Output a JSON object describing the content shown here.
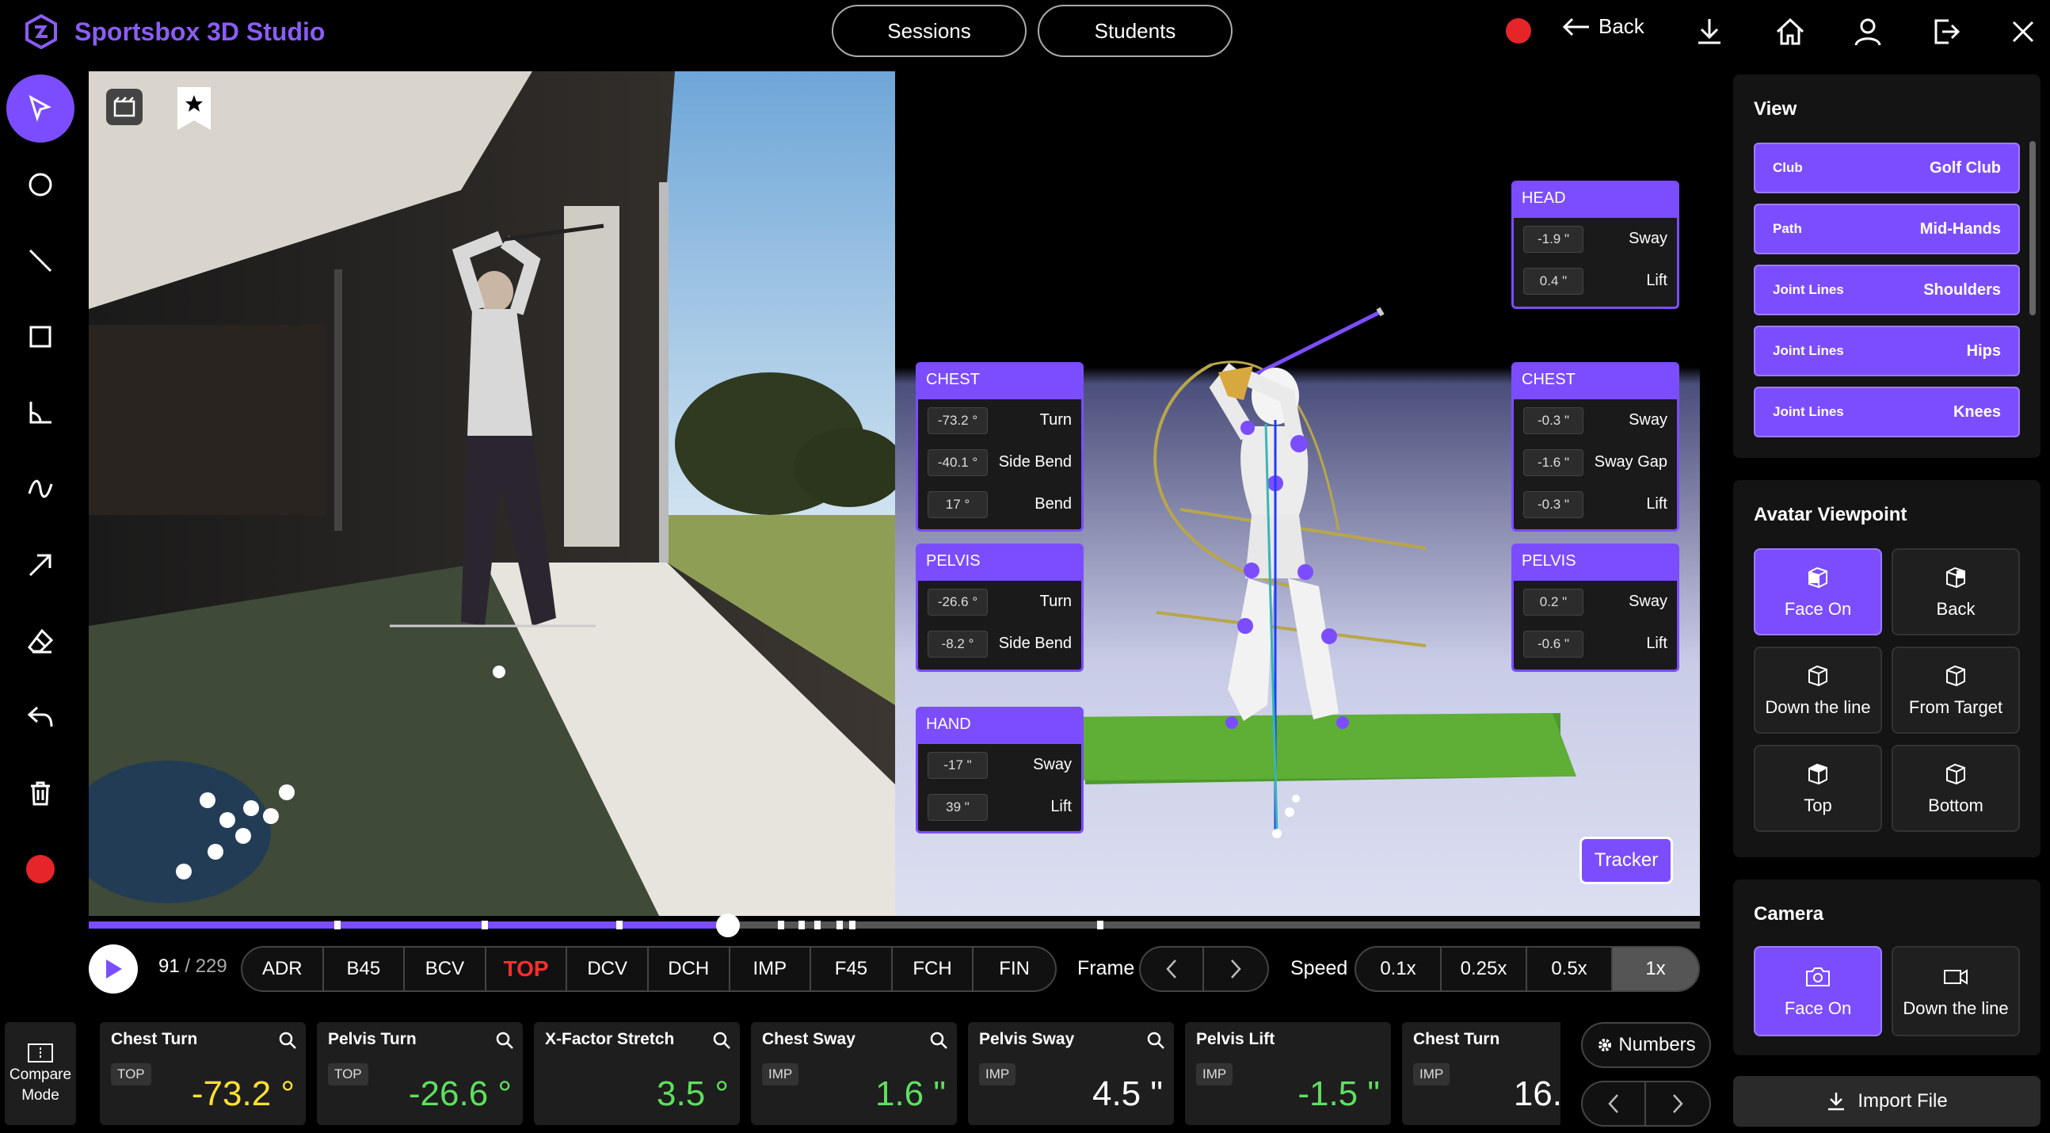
{
  "app": {
    "title": "Sportsbox 3D Studio"
  },
  "header": {
    "sessions_label": "Sessions",
    "students_label": "Students",
    "back_label": "Back"
  },
  "colors": {
    "accent": "#7c4dff",
    "record": "#e5252a",
    "negative": "#ff3b3b",
    "warning": "#ffe033",
    "positive": "#5ee05e"
  },
  "scene": {
    "head": {
      "title": "HEAD",
      "rows": [
        {
          "value": "-1.9 \"",
          "label": "Sway"
        },
        {
          "value": "0.4 \"",
          "label": "Lift"
        }
      ]
    },
    "chest_left": {
      "title": "CHEST",
      "rows": [
        {
          "value": "-73.2 °",
          "label": "Turn"
        },
        {
          "value": "-40.1 °",
          "label": "Side Bend"
        },
        {
          "value": "17 °",
          "label": "Bend"
        }
      ]
    },
    "pelvis_left": {
      "title": "PELVIS",
      "rows": [
        {
          "value": "-26.6 °",
          "label": "Turn"
        },
        {
          "value": "-8.2 °",
          "label": "Side Bend"
        }
      ]
    },
    "hand": {
      "title": "HAND",
      "rows": [
        {
          "value": "-17 \"",
          "label": "Sway"
        },
        {
          "value": "39 \"",
          "label": "Lift"
        }
      ]
    },
    "chest_right": {
      "title": "CHEST",
      "rows": [
        {
          "value": "-0.3 \"",
          "label": "Sway"
        },
        {
          "value": "-1.6 \"",
          "label": "Sway Gap"
        },
        {
          "value": "-0.3 \"",
          "label": "Lift"
        }
      ]
    },
    "pelvis_right": {
      "title": "PELVIS",
      "rows": [
        {
          "value": "0.2 \"",
          "label": "Sway"
        },
        {
          "value": "-0.6 \"",
          "label": "Lift"
        }
      ]
    },
    "tracker_label": "Tracker"
  },
  "right_panel": {
    "view_title": "View",
    "view_items": [
      {
        "key": "Club",
        "value": "Golf Club"
      },
      {
        "key": "Path",
        "value": "Mid-Hands"
      },
      {
        "key": "Joint Lines",
        "value": "Shoulders"
      },
      {
        "key": "Joint Lines",
        "value": "Hips"
      },
      {
        "key": "Joint Lines",
        "value": "Knees"
      }
    ],
    "viewpoint_title": "Avatar Viewpoint",
    "viewpoints": [
      "Face On",
      "Back",
      "Down the line",
      "From Target",
      "Top",
      "Bottom"
    ],
    "camera_title": "Camera",
    "cameras": [
      "Face On",
      "Down the line"
    ],
    "import_label": "Import File"
  },
  "playback": {
    "frame_current": "91",
    "frame_total": "/ 229",
    "progress": 0.397,
    "positions": [
      "ADR",
      "B45",
      "BCV",
      "TOP",
      "DCV",
      "DCH",
      "IMP",
      "F45",
      "FCH",
      "FIN"
    ],
    "active_position": "TOP",
    "frame_label": "Frame",
    "speed_label": "Speed",
    "speeds": [
      "0.1x",
      "0.25x",
      "0.5x",
      "1x"
    ],
    "active_speed": "1x"
  },
  "bottom": {
    "compare_label_1": "Compare",
    "compare_label_2": "Mode",
    "numbers_label": "Numbers",
    "cards": [
      {
        "title": "Chest Turn",
        "badge": "TOP",
        "value": "-73.2 °",
        "color": "#ff3b3b"
      },
      {
        "title": "Pelvis Turn",
        "badge": "TOP",
        "value": "-26.6 °",
        "color": "#ffe033"
      },
      {
        "title": "X-Factor Stretch",
        "badge": "",
        "value": "3.5 °",
        "color": "#5ee05e"
      },
      {
        "title": "Chest Sway",
        "badge": "IMP",
        "value": "1.6 \"",
        "color": "#5ee05e"
      },
      {
        "title": "Pelvis Sway",
        "badge": "IMP",
        "value": "4.5 \"",
        "color": "#5ee05e"
      },
      {
        "title": "Pelvis Lift",
        "badge": "IMP",
        "value": "-1.5 \"",
        "color": "#ffffff"
      },
      {
        "title": "Chest Turn",
        "badge": "IMP",
        "value": "16.",
        "color": "#5ee05e"
      }
    ]
  }
}
